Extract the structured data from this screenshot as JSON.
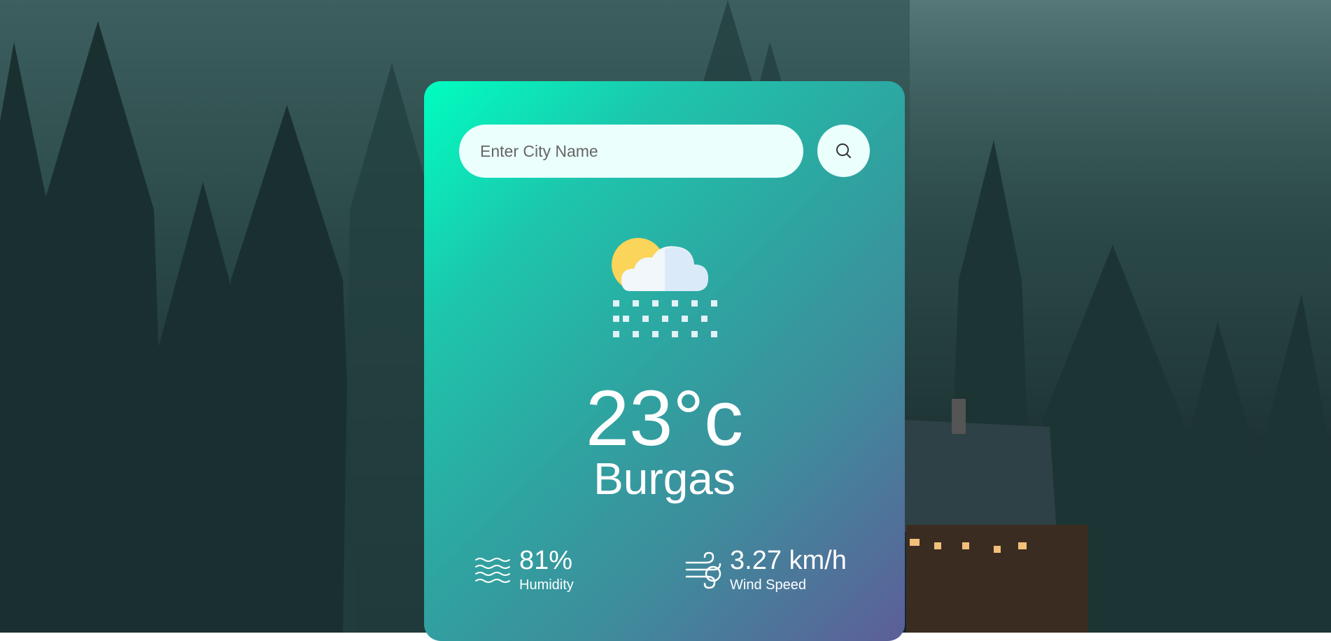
{
  "search": {
    "placeholder": "Enter City Name",
    "value": ""
  },
  "weather": {
    "icon": "sun-cloud-snow-icon",
    "temperature": "23°c",
    "city": "Burgas"
  },
  "details": {
    "humidity": {
      "value": "81%",
      "label": "Humidity",
      "icon": "humidity-waves-icon"
    },
    "wind": {
      "value": "3.27 km/h",
      "label": "Wind Speed",
      "icon": "wind-icon"
    }
  },
  "colors": {
    "card_gradient_start": "#00fec0",
    "card_gradient_end": "#5d5e98",
    "input_background": "#ebfffc",
    "text": "#ffffff"
  }
}
